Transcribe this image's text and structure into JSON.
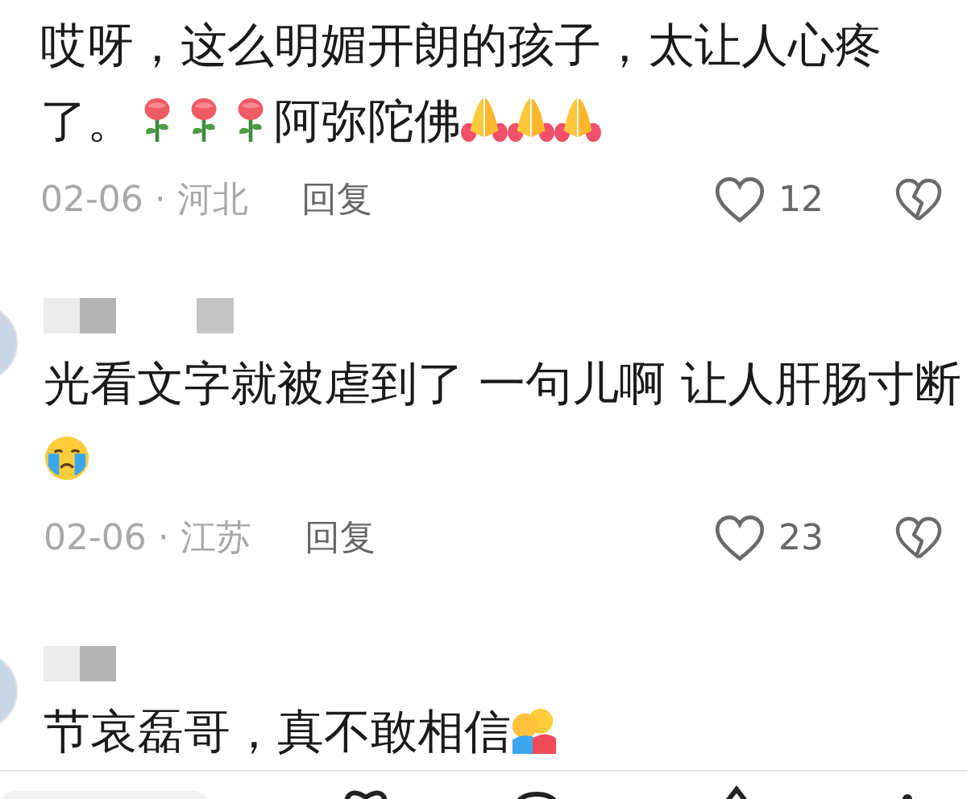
{
  "comments": [
    {
      "content": [
        {
          "kind": "text",
          "text": "哎呀，这么明媚开朗的孩子，太让人心疼"
        },
        {
          "kind": "text",
          "text": "了。"
        },
        {
          "kind": "rose"
        },
        {
          "kind": "rose"
        },
        {
          "kind": "rose"
        },
        {
          "kind": "text",
          "text": "阿弥陀佛"
        },
        {
          "kind": "pray"
        },
        {
          "kind": "pray"
        },
        {
          "kind": "pray"
        }
      ],
      "date": "02-06 · 河北",
      "reply": "回复",
      "likes": "12",
      "liked": false
    },
    {
      "avatar": true,
      "name_hidden": true,
      "content": [
        {
          "kind": "text",
          "text": "光看文字就被虐到了 一句儿啊 让人肝肠寸"
        },
        {
          "kind": "text",
          "text": "断"
        },
        {
          "kind": "cry"
        }
      ],
      "date": "02-06 · 江苏",
      "reply": "回复",
      "likes": "23",
      "liked": false
    },
    {
      "avatar": true,
      "name_hidden": true,
      "content": [
        {
          "kind": "text",
          "text": "节哀磊哥，真不敢相信"
        },
        {
          "kind": "hug"
        }
      ]
    }
  ]
}
